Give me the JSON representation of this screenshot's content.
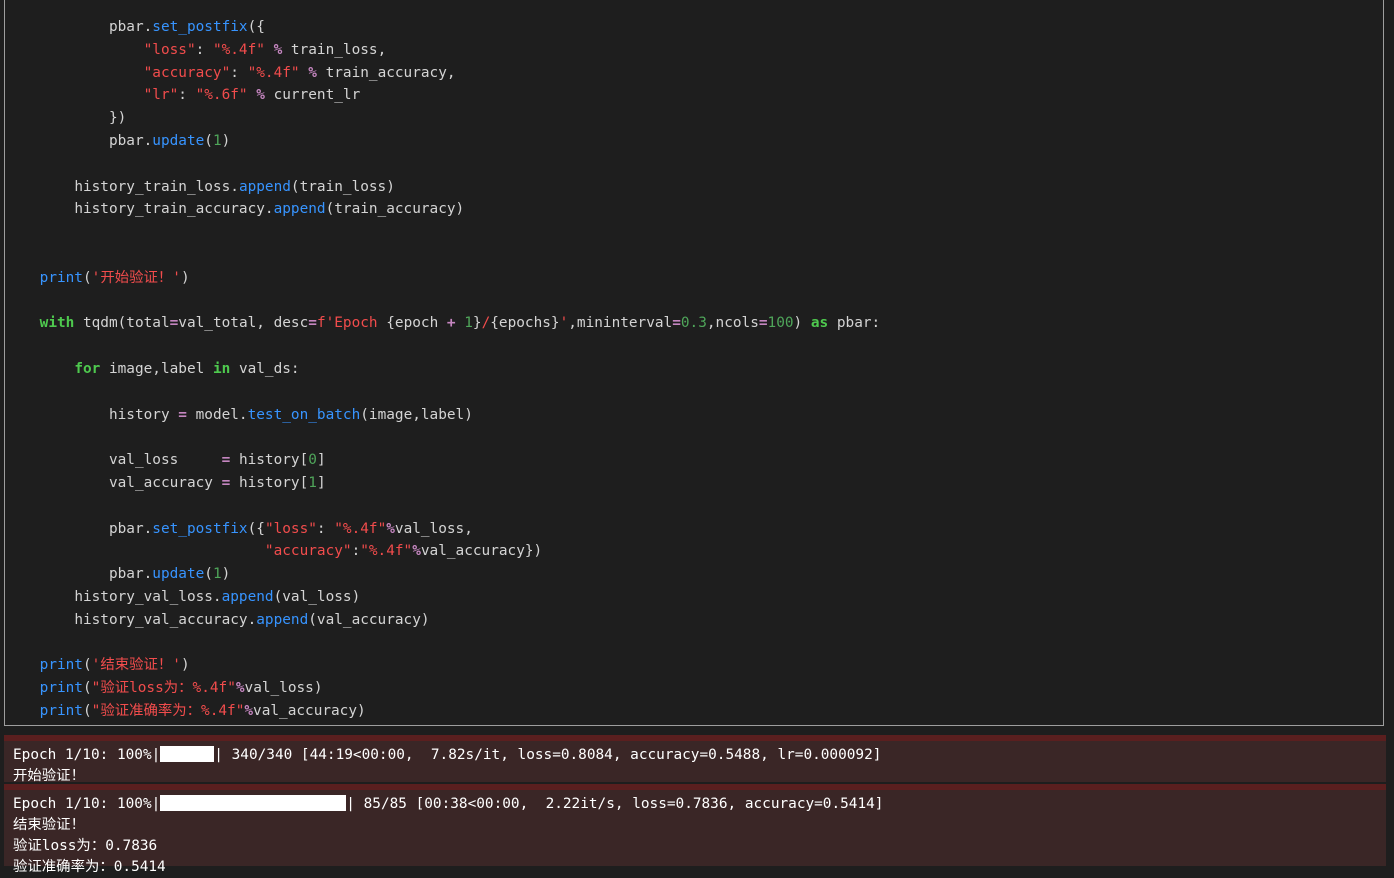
{
  "code_lines": [
    [
      [
        "i",
        "        "
      ],
      [
        "x",
        "pbar."
      ],
      [
        "f",
        "set_postfix"
      ],
      [
        "x",
        "({"
      ]
    ],
    [
      [
        "i",
        "            "
      ],
      [
        "s",
        "\"loss\""
      ],
      [
        "x",
        ": "
      ],
      [
        "s",
        "\"%.4f\""
      ],
      [
        "x",
        " "
      ],
      [
        "o",
        "%"
      ],
      [
        "x",
        " train_loss,"
      ]
    ],
    [
      [
        "i",
        "            "
      ],
      [
        "s",
        "\"accuracy\""
      ],
      [
        "x",
        ": "
      ],
      [
        "s",
        "\"%.4f\""
      ],
      [
        "x",
        " "
      ],
      [
        "o",
        "%"
      ],
      [
        "x",
        " train_accuracy,"
      ]
    ],
    [
      [
        "i",
        "            "
      ],
      [
        "s",
        "\"lr\""
      ],
      [
        "x",
        ": "
      ],
      [
        "s",
        "\"%.6f\""
      ],
      [
        "x",
        " "
      ],
      [
        "o",
        "%"
      ],
      [
        "x",
        " current_lr"
      ]
    ],
    [
      [
        "i",
        "        "
      ],
      [
        "x",
        "})"
      ]
    ],
    [
      [
        "i",
        "        "
      ],
      [
        "x",
        "pbar."
      ],
      [
        "f",
        "update"
      ],
      [
        "x",
        "("
      ],
      [
        "n",
        "1"
      ],
      [
        "x",
        ")"
      ]
    ],
    [],
    [
      [
        "i",
        "    "
      ],
      [
        "x",
        "history_train_loss."
      ],
      [
        "f",
        "append"
      ],
      [
        "x",
        "(train_loss)"
      ]
    ],
    [
      [
        "i",
        "    "
      ],
      [
        "x",
        "history_train_accuracy."
      ],
      [
        "f",
        "append"
      ],
      [
        "x",
        "(train_accuracy)"
      ]
    ],
    [],
    [],
    [
      [
        "f",
        "print"
      ],
      [
        "x",
        "("
      ],
      [
        "s",
        "'开始验证！'"
      ],
      [
        "x",
        ")"
      ]
    ],
    [],
    [
      [
        "k",
        "with"
      ],
      [
        "x",
        " tqdm(total"
      ],
      [
        "o",
        "="
      ],
      [
        "x",
        "val_total, desc"
      ],
      [
        "o",
        "="
      ],
      [
        "s",
        "f'Epoch "
      ],
      [
        "x",
        "{epoch "
      ],
      [
        "o",
        "+"
      ],
      [
        "x",
        " "
      ],
      [
        "n",
        "1"
      ],
      [
        "x",
        "}"
      ],
      [
        "s",
        "/"
      ],
      [
        "x",
        "{epochs}"
      ],
      [
        "s",
        "'"
      ],
      [
        "x",
        ",mininterval"
      ],
      [
        "o",
        "="
      ],
      [
        "n",
        "0.3"
      ],
      [
        "x",
        ",ncols"
      ],
      [
        "o",
        "="
      ],
      [
        "n",
        "100"
      ],
      [
        "x",
        ") "
      ],
      [
        "k",
        "as"
      ],
      [
        "x",
        " pbar:"
      ]
    ],
    [],
    [
      [
        "i",
        "    "
      ],
      [
        "k",
        "for"
      ],
      [
        "x",
        " image,label "
      ],
      [
        "k",
        "in"
      ],
      [
        "x",
        " val_ds:"
      ]
    ],
    [],
    [
      [
        "i",
        "        "
      ],
      [
        "x",
        "history "
      ],
      [
        "o",
        "="
      ],
      [
        "x",
        " model."
      ],
      [
        "f",
        "test_on_batch"
      ],
      [
        "x",
        "(image,label)"
      ]
    ],
    [],
    [
      [
        "i",
        "        "
      ],
      [
        "x",
        "val_loss     "
      ],
      [
        "o",
        "="
      ],
      [
        "x",
        " history["
      ],
      [
        "n",
        "0"
      ],
      [
        "x",
        "]"
      ]
    ],
    [
      [
        "i",
        "        "
      ],
      [
        "x",
        "val_accuracy "
      ],
      [
        "o",
        "="
      ],
      [
        "x",
        " history["
      ],
      [
        "n",
        "1"
      ],
      [
        "x",
        "]"
      ]
    ],
    [],
    [
      [
        "i",
        "        "
      ],
      [
        "x",
        "pbar."
      ],
      [
        "f",
        "set_postfix"
      ],
      [
        "x",
        "({"
      ],
      [
        "s",
        "\"loss\""
      ],
      [
        "x",
        ": "
      ],
      [
        "s",
        "\"%.4f\""
      ],
      [
        "o",
        "%"
      ],
      [
        "x",
        "val_loss,"
      ]
    ],
    [
      [
        "i",
        "                          "
      ],
      [
        "s",
        "\"accuracy\""
      ],
      [
        "x",
        ":"
      ],
      [
        "s",
        "\"%.4f\""
      ],
      [
        "o",
        "%"
      ],
      [
        "x",
        "val_accuracy})"
      ]
    ],
    [
      [
        "i",
        "        "
      ],
      [
        "x",
        "pbar."
      ],
      [
        "f",
        "update"
      ],
      [
        "x",
        "("
      ],
      [
        "n",
        "1"
      ],
      [
        "x",
        ")"
      ]
    ],
    [
      [
        "i",
        "    "
      ],
      [
        "x",
        "history_val_loss."
      ],
      [
        "f",
        "append"
      ],
      [
        "x",
        "(val_loss)"
      ]
    ],
    [
      [
        "i",
        "    "
      ],
      [
        "x",
        "history_val_accuracy."
      ],
      [
        "f",
        "append"
      ],
      [
        "x",
        "(val_accuracy)"
      ]
    ],
    [],
    [
      [
        "f",
        "print"
      ],
      [
        "x",
        "("
      ],
      [
        "s",
        "'结束验证！'"
      ],
      [
        "x",
        ")"
      ]
    ],
    [
      [
        "f",
        "print"
      ],
      [
        "x",
        "("
      ],
      [
        "s",
        "\"验证loss为：%.4f\""
      ],
      [
        "o",
        "%"
      ],
      [
        "x",
        "val_loss)"
      ]
    ],
    [
      [
        "f",
        "print"
      ],
      [
        "x",
        "("
      ],
      [
        "s",
        "\"验证准确率为：%.4f\""
      ],
      [
        "o",
        "%"
      ],
      [
        "x",
        "val_accuracy)"
      ]
    ]
  ],
  "outputs": {
    "train_progress": {
      "prefix": "Epoch 1/10: 100%|",
      "suffix": "| 340/340 [44:19<00:00,  7.82s/it, loss=0.8084, accuracy=0.5488, lr=0.000092]",
      "fill": 1.0
    },
    "start_msg": "开始验证！",
    "val_progress": {
      "prefix": "Epoch 1/10: 100%|",
      "suffix": "| 85/85 [00:38<00:00,  2.22it/s, loss=0.7836, accuracy=0.5414]",
      "fill": 1.0
    },
    "end_msg": "结束验证！",
    "val_loss_msg": "验证loss为：0.7836",
    "val_acc_msg": "验证准确率为：0.5414"
  }
}
